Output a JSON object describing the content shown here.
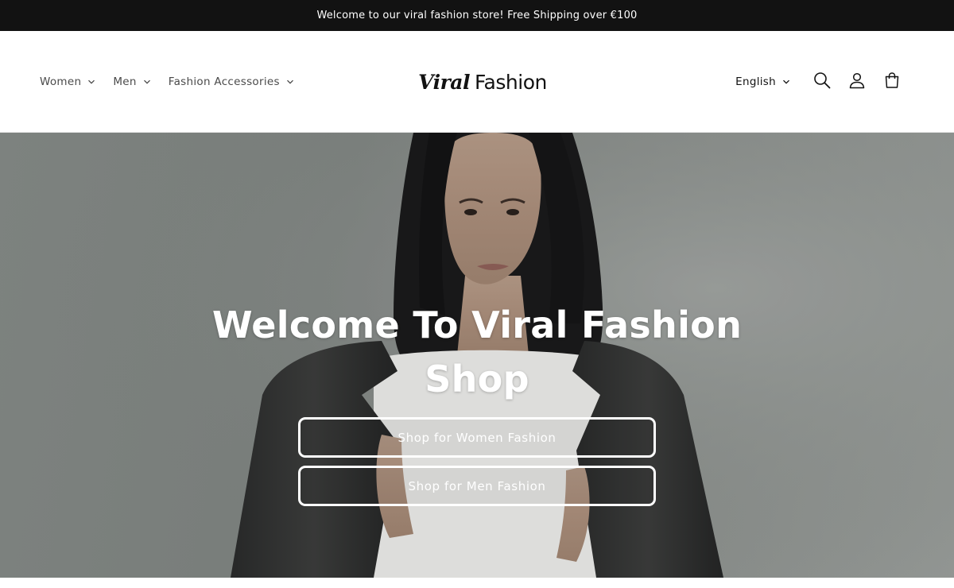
{
  "announcement": {
    "text": "Welcome to our viral fashion store! Free Shipping over €100"
  },
  "nav": {
    "items": [
      {
        "label": "Women"
      },
      {
        "label": "Men"
      },
      {
        "label": "Fashion Accessories"
      }
    ]
  },
  "logo": {
    "part1": "Viral",
    "part2": "Fashion"
  },
  "header_tools": {
    "language": "English",
    "icons": [
      "search-icon",
      "account-icon",
      "cart-icon"
    ]
  },
  "hero": {
    "title": "Welcome To Viral Fashion Shop",
    "buttons": [
      {
        "label": "Shop for Women Fashion"
      },
      {
        "label": "Shop for Men Fashion"
      }
    ]
  },
  "colors": {
    "announcement_bg": "#121212",
    "text": "#121212",
    "nav_text": "#4a4a4a",
    "hero_button_border": "#ffffff"
  }
}
